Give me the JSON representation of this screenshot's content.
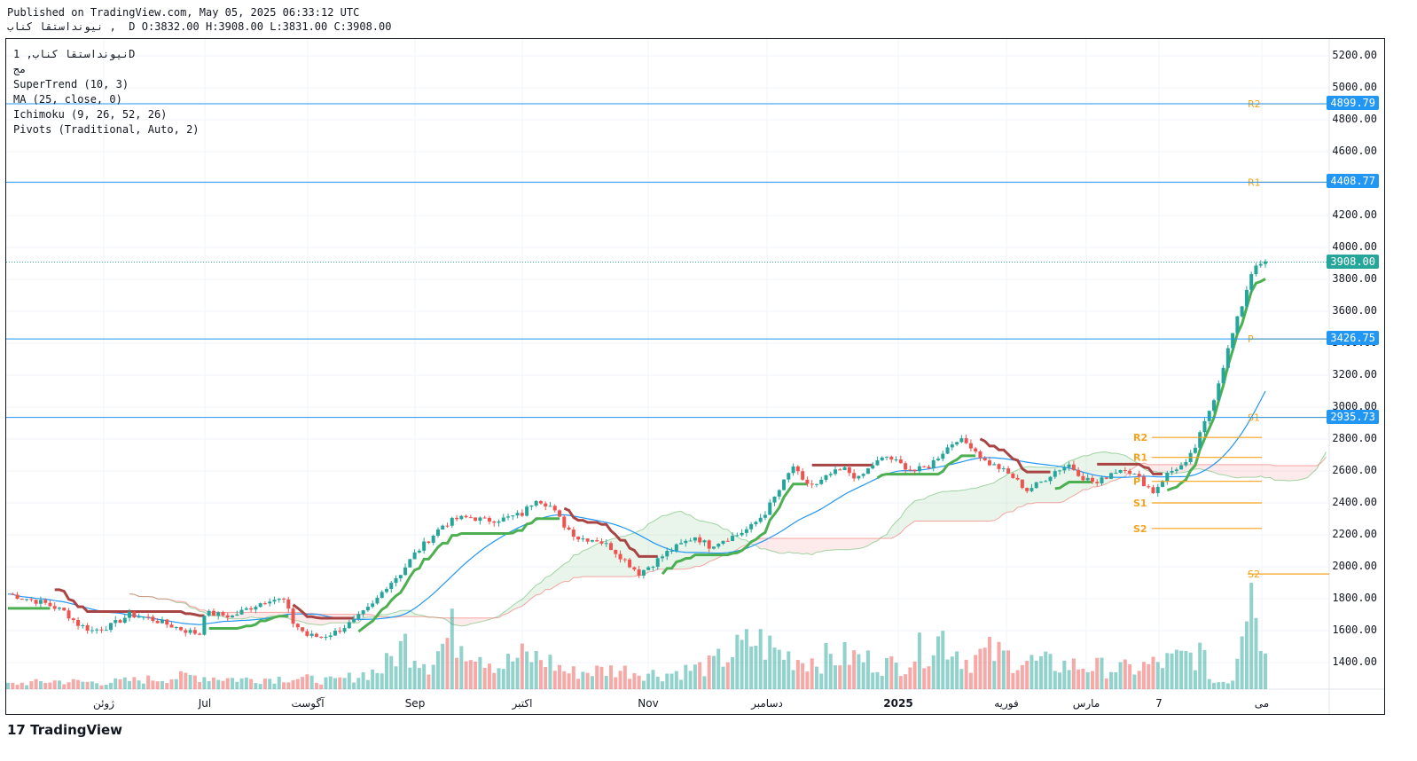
{
  "header": {
    "published": "Published on TradingView.com, May 05, 2025 06:33:12 UTC",
    "ohlc": "نيونداستقا كناب ,  D O:3832.00 H:3908.00 L:3831.00 C:3908.00"
  },
  "legend": {
    "symbol": "نيونداستقا كناب, 1D",
    "exchange": "مج",
    "indicators": [
      "SuperTrend (10, 3)",
      "MA (25, close, 0)",
      "Ichimoku (9, 26, 52, 26)",
      "Pivots (Traditional, Auto, 2)"
    ]
  },
  "logo": "TradingView",
  "colors": {
    "up": "#26a69a",
    "down": "#ef5350",
    "supertrend_up": "#4caf50",
    "supertrend_down": "#a84444",
    "ma": "#2196f3",
    "pivot": "#f7a21b",
    "hline": "#2196f3",
    "last": "#26a69a"
  },
  "chart_data": {
    "type": "candlestick",
    "ylim": [
      1200,
      5300
    ],
    "y_ticks": [
      "1400.00",
      "1600.00",
      "1800.00",
      "2000.00",
      "2200.00",
      "2400.00",
      "2600.00",
      "2800.00",
      "3000.00",
      "3200.00",
      "3400.00",
      "3600.00",
      "3800.00",
      "4000.00",
      "4200.00",
      "4400.00",
      "4600.00",
      "4800.00",
      "5000.00",
      "5200.00"
    ],
    "x_ticks": [
      "ژوئن",
      "Jul",
      "آگوست",
      "Sep",
      "اکتبر",
      "Nov",
      "دسامبر",
      "2025",
      "فوریه",
      "مارس",
      "7",
      "می"
    ],
    "horizontal_levels": [
      {
        "value": 4899.79,
        "label": "4899.79"
      },
      {
        "value": 4408.77,
        "label": "4408.77"
      },
      {
        "value": 3426.75,
        "label": "3426.75"
      },
      {
        "value": 2935.73,
        "label": "2935.73"
      }
    ],
    "last_price": {
      "value": 3908.0,
      "label": "3908.00"
    },
    "pivots_current": [
      {
        "name": "R2",
        "value": 4899.79
      },
      {
        "name": "R1",
        "value": 4408.77
      },
      {
        "name": "P",
        "value": 3426.75
      },
      {
        "name": "S1",
        "value": 2935.73
      },
      {
        "name": "S2",
        "value": 1955
      }
    ],
    "pivots_previous": [
      {
        "name": "R2",
        "value": 2810
      },
      {
        "name": "R1",
        "value": 2685
      },
      {
        "name": "P",
        "value": 2535
      },
      {
        "name": "S1",
        "value": 2400
      },
      {
        "name": "S2",
        "value": 2240
      }
    ],
    "price_path": [
      [
        0,
        1830
      ],
      [
        4,
        1800
      ],
      [
        8,
        1770
      ],
      [
        12,
        1720
      ],
      [
        15,
        1640
      ],
      [
        18,
        1600
      ],
      [
        22,
        1630
      ],
      [
        26,
        1700
      ],
      [
        30,
        1680
      ],
      [
        34,
        1640
      ],
      [
        38,
        1600
      ],
      [
        41,
        1580
      ],
      [
        42,
        1710
      ],
      [
        45,
        1700
      ],
      [
        48,
        1690
      ],
      [
        50,
        1720
      ],
      [
        53,
        1760
      ],
      [
        56,
        1800
      ],
      [
        59,
        1790
      ],
      [
        61,
        1650
      ],
      [
        64,
        1570
      ],
      [
        67,
        1560
      ],
      [
        70,
        1590
      ],
      [
        74,
        1660
      ],
      [
        78,
        1760
      ],
      [
        81,
        1880
      ],
      [
        84,
        1960
      ],
      [
        87,
        2080
      ],
      [
        90,
        2170
      ],
      [
        93,
        2260
      ],
      [
        96,
        2300
      ],
      [
        99,
        2310
      ],
      [
        102,
        2290
      ],
      [
        106,
        2300
      ],
      [
        110,
        2330
      ],
      [
        113,
        2430
      ],
      [
        116,
        2380
      ],
      [
        119,
        2260
      ],
      [
        122,
        2180
      ],
      [
        126,
        2170
      ],
      [
        129,
        2120
      ],
      [
        132,
        2040
      ],
      [
        135,
        1960
      ],
      [
        138,
        2020
      ],
      [
        141,
        2090
      ],
      [
        144,
        2140
      ],
      [
        147,
        2190
      ],
      [
        150,
        2130
      ],
      [
        153,
        2170
      ],
      [
        156,
        2200
      ],
      [
        159,
        2250
      ],
      [
        162,
        2340
      ],
      [
        165,
        2480
      ],
      [
        168,
        2630
      ],
      [
        170,
        2530
      ],
      [
        173,
        2510
      ],
      [
        176,
        2580
      ],
      [
        179,
        2610
      ],
      [
        182,
        2550
      ],
      [
        185,
        2640
      ],
      [
        188,
        2690
      ],
      [
        191,
        2640
      ],
      [
        194,
        2600
      ],
      [
        197,
        2630
      ],
      [
        200,
        2720
      ],
      [
        203,
        2800
      ],
      [
        206,
        2760
      ],
      [
        209,
        2660
      ],
      [
        212,
        2620
      ],
      [
        215,
        2560
      ],
      [
        218,
        2480
      ],
      [
        221,
        2530
      ],
      [
        224,
        2600
      ],
      [
        227,
        2640
      ],
      [
        230,
        2560
      ],
      [
        233,
        2520
      ],
      [
        236,
        2590
      ],
      [
        239,
        2620
      ],
      [
        242,
        2550
      ],
      [
        245,
        2470
      ],
      [
        248,
        2580
      ],
      [
        250,
        2620
      ],
      [
        252,
        2640
      ],
      [
        254,
        2750
      ],
      [
        256,
        2900
      ],
      [
        258,
        3060
      ],
      [
        260,
        3260
      ],
      [
        262,
        3460
      ],
      [
        264,
        3640
      ],
      [
        265,
        3740
      ],
      [
        266,
        3840
      ],
      [
        267,
        3900
      ],
      [
        268,
        3880
      ],
      [
        269,
        3908
      ]
    ],
    "volume": [
      [
        0,
        3
      ],
      [
        10,
        5
      ],
      [
        20,
        4
      ],
      [
        30,
        6
      ],
      [
        40,
        8
      ],
      [
        50,
        6
      ],
      [
        60,
        7
      ],
      [
        70,
        5
      ],
      [
        80,
        12
      ],
      [
        85,
        28
      ],
      [
        90,
        16
      ],
      [
        95,
        34
      ],
      [
        100,
        26
      ],
      [
        105,
        14
      ],
      [
        110,
        20
      ],
      [
        115,
        18
      ],
      [
        120,
        10
      ],
      [
        130,
        12
      ],
      [
        140,
        9
      ],
      [
        150,
        14
      ],
      [
        160,
        30
      ],
      [
        165,
        22
      ],
      [
        170,
        18
      ],
      [
        180,
        20
      ],
      [
        190,
        14
      ],
      [
        200,
        32
      ],
      [
        205,
        18
      ],
      [
        210,
        22
      ],
      [
        220,
        16
      ],
      [
        230,
        14
      ],
      [
        240,
        12
      ],
      [
        250,
        18
      ],
      [
        255,
        22
      ],
      [
        258,
        4
      ],
      [
        262,
        6
      ],
      [
        265,
        62
      ],
      [
        266,
        100
      ],
      [
        267,
        65
      ],
      [
        268,
        30
      ],
      [
        269,
        22
      ]
    ],
    "series": [
      {
        "name": "SuperTrend",
        "style": "step"
      },
      {
        "name": "MA",
        "style": "line"
      },
      {
        "name": "Ichimoku",
        "style": "cloud"
      }
    ]
  }
}
